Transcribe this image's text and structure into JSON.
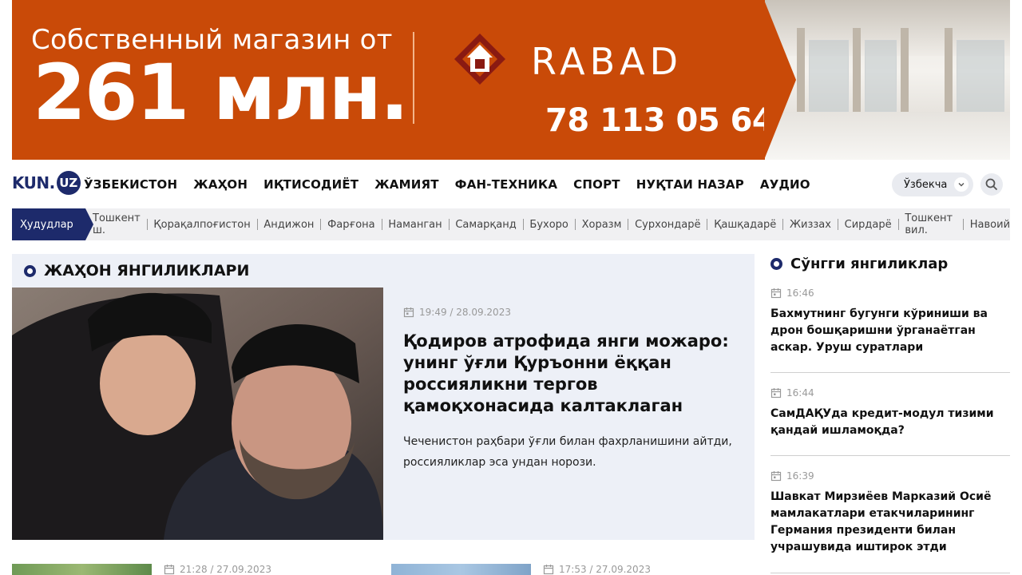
{
  "banner": {
    "subtitle": "Собственный магазин от",
    "price": "261 млн.",
    "brand": "RABAD",
    "phone": "78 113 05 64",
    "color": "#c94a08"
  },
  "header": {
    "logo_text": "KUN.",
    "logo_badge": "UZ",
    "nav": [
      "ЎЗБЕКИСТОН",
      "ЖАҲОН",
      "ИҚТИСОДИЁТ",
      "ЖАМИЯТ",
      "ФАН-ТЕХНИКА",
      "СПОРТ",
      "НУҚТАИ НАЗАР",
      "АУДИО"
    ],
    "language": "Ўзбекча"
  },
  "regions": {
    "label": "Ҳудудлар",
    "items": [
      "Тошкент ш.",
      "Қорақалпоғистон",
      "Андижон",
      "Фарғона",
      "Наманган",
      "Самарқанд",
      "Бухоро",
      "Хоразм",
      "Сурхондарё",
      "Қашқадарё",
      "Жиззах",
      "Сирдарё",
      "Тошкент вил.",
      "Навоий"
    ]
  },
  "world": {
    "section_title": "ЖАҲОН ЯНГИЛИКЛАРИ",
    "featured": {
      "datetime": "19:49 / 28.09.2023",
      "title": "Қодиров атрофида янги можаро: унинг ўғли Қуръонни ёққан россияликни тергов қамоқхонасида калтаклаган",
      "lead": "Чеченистон раҳбари ўғли билан фахрланишини айтди, россияликлар эса ундан норози."
    },
    "more": [
      {
        "datetime": "21:28 / 27.09.2023"
      },
      {
        "datetime": "17:53 / 27.09.2023"
      }
    ]
  },
  "latest": {
    "section_title": "Сўнгги янгиликлар",
    "items": [
      {
        "time": "16:46",
        "title": "Бахмутнинг бугунги кўриниши ва дрон бошқаришни ўрганаётган аскар. Уруш суратлари"
      },
      {
        "time": "16:44",
        "title": "СамДАҚУда кредит-модул тизими қандай ишламоқда?"
      },
      {
        "time": "16:39",
        "title": "Шавкат Мирзиёев Марказий Осиё мамлакатлари етакчиларининг Германия президенти билан учрашувида иштирок этди"
      }
    ]
  },
  "colors": {
    "brand": "#1d2a6b",
    "section_bg": "#edf0f7",
    "regions_bg": "#f0f0f2"
  },
  "icons": {
    "search": "search-icon",
    "calendar": "calendar-icon",
    "chevron": "chevron-down-icon"
  }
}
